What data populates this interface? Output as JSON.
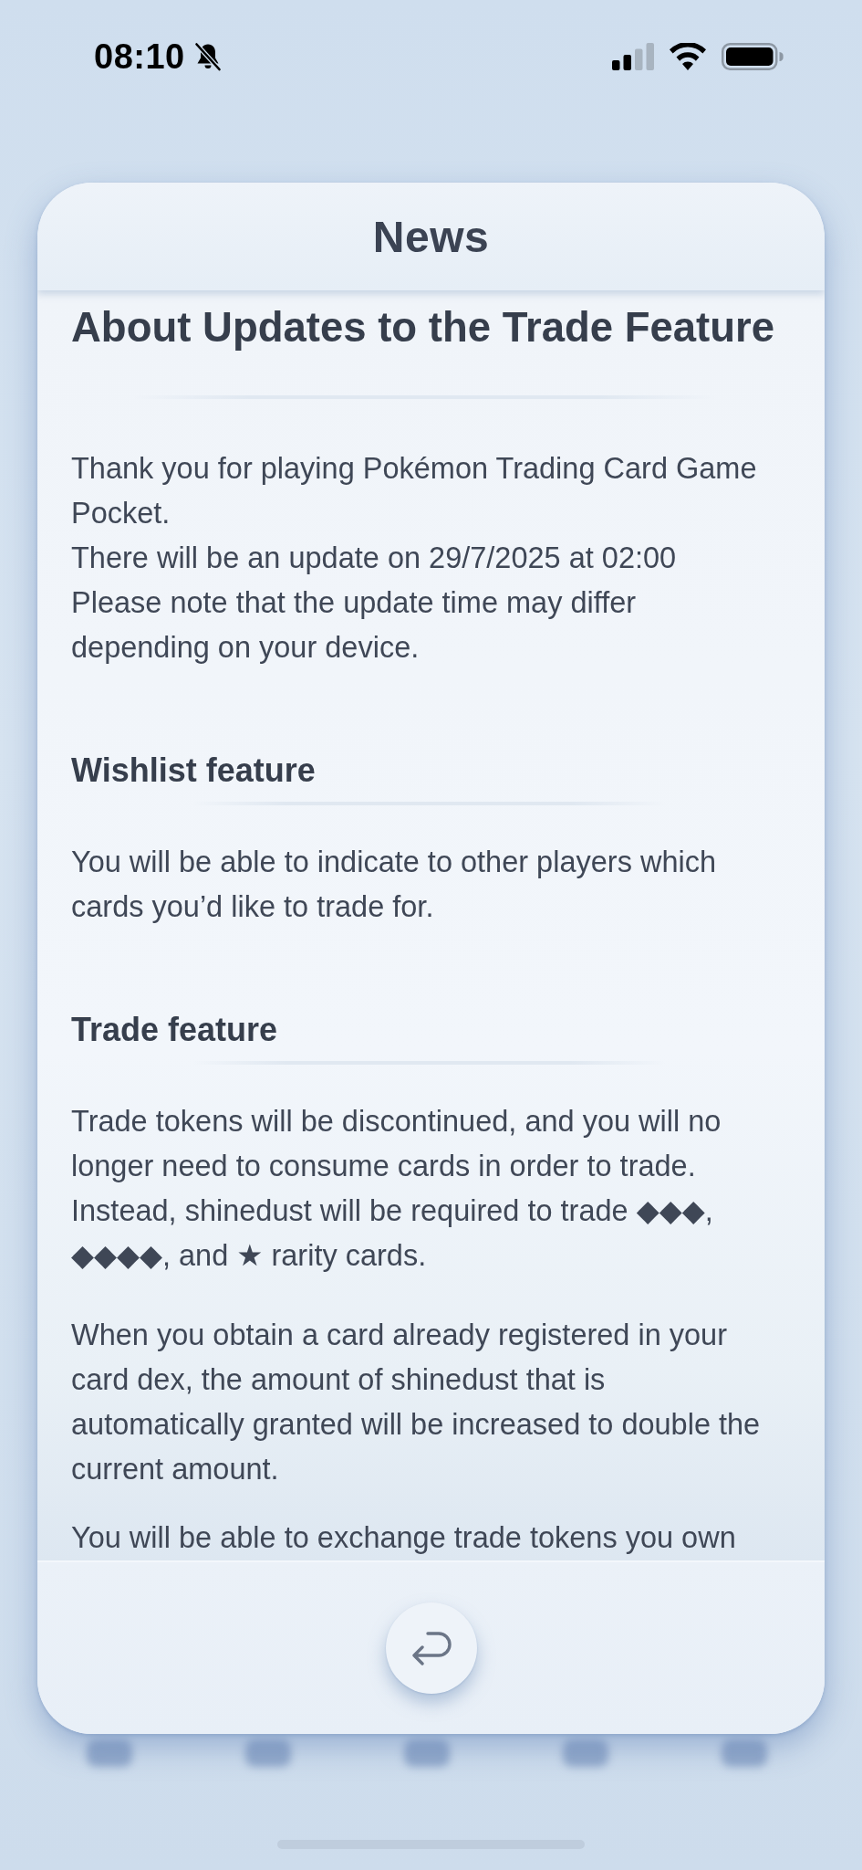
{
  "status_bar": {
    "time": "08:10"
  },
  "dialog": {
    "title": "News"
  },
  "article": {
    "title": "About Updates to the Trade Feature",
    "blocks": [
      {
        "kind": "paragraph",
        "text": "Thank you for playing Pokémon Trading Card Game Pocket.\nThere will be an update on 29/7/2025 at 02:00\nPlease note that the update time may differ depending on your device."
      },
      {
        "kind": "heading",
        "text": "Wishlist feature"
      },
      {
        "kind": "paragraph",
        "text": "You will be able to indicate to other players which cards you’d like to trade for."
      },
      {
        "kind": "heading",
        "text": "Trade feature"
      },
      {
        "kind": "paragraph",
        "text": "Trade tokens will be discontinued, and you will no longer need to consume cards in order to trade. Instead, shinedust will be required to trade ◆◆◆, ◆◆◆◆, and ★ rarity cards."
      },
      {
        "kind": "paragraph",
        "text": "When you obtain a card already registered in your card dex, the amount of shinedust that is automatically granted will be increased to double the current amount."
      },
      {
        "kind": "paragraph",
        "text": "You will be able to exchange trade tokens you own"
      }
    ]
  }
}
